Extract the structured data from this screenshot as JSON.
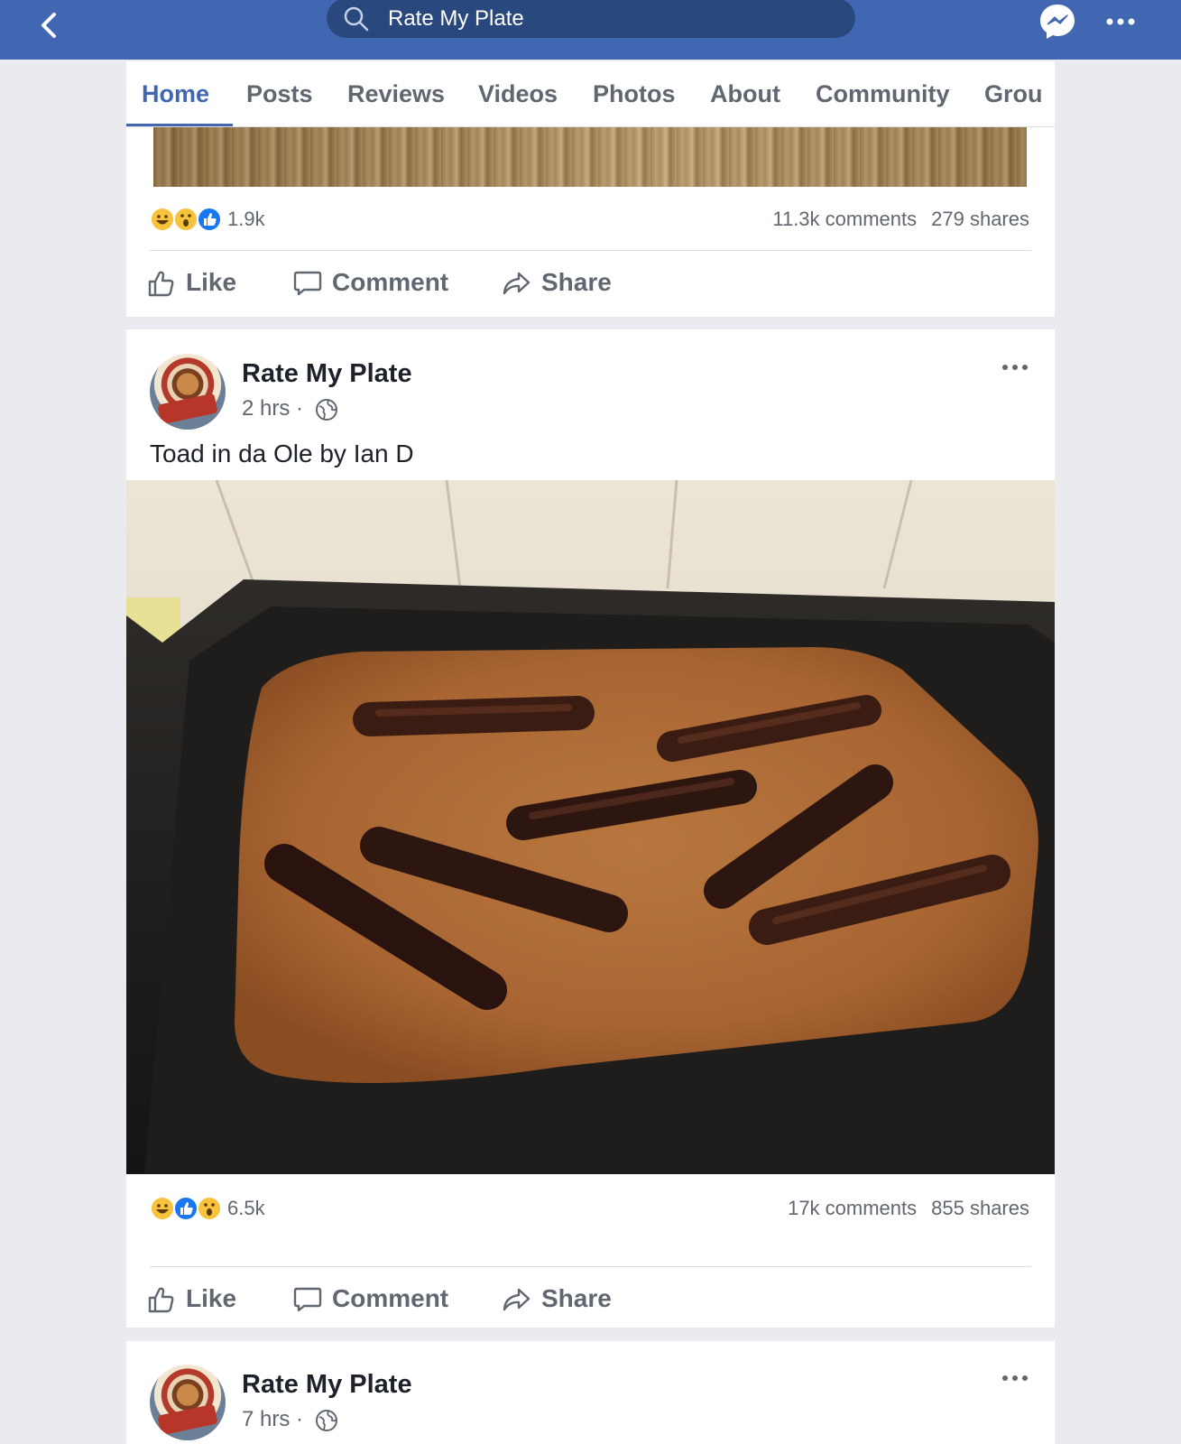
{
  "topbar": {
    "search_text": "Rate My Plate",
    "color": "#4267b2"
  },
  "tabs": [
    {
      "label": "Home",
      "active": true
    },
    {
      "label": "Posts"
    },
    {
      "label": "Reviews"
    },
    {
      "label": "Videos"
    },
    {
      "label": "Photos"
    },
    {
      "label": "About"
    },
    {
      "label": "Community"
    },
    {
      "label": "Grou"
    }
  ],
  "posts": [
    {
      "reactions": [
        "haha",
        "wow",
        "like"
      ],
      "reaction_count": "1.9k",
      "comments": "11.3k comments",
      "shares": "279 shares",
      "actions": {
        "like": "Like",
        "comment": "Comment",
        "share": "Share"
      }
    },
    {
      "page_name": "Rate My Plate",
      "time": "2 hrs",
      "text": "Toad in da Ole by Ian D",
      "reactions": [
        "haha",
        "like",
        "wow"
      ],
      "reaction_count": "6.5k",
      "comments": "17k comments",
      "shares": "855 shares",
      "actions": {
        "like": "Like",
        "comment": "Comment",
        "share": "Share"
      }
    },
    {
      "page_name": "Rate My Plate",
      "time": "7 hrs"
    }
  ],
  "colors": {
    "accent": "#4267b2",
    "text_secondary": "#606770",
    "background": "#e9ebee"
  }
}
